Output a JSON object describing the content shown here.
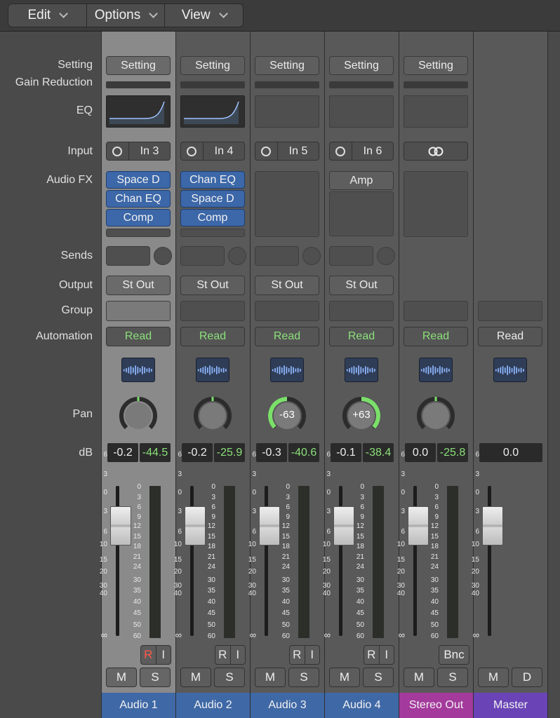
{
  "menubar": [
    {
      "label": "Edit"
    },
    {
      "label": "Options"
    },
    {
      "label": "View"
    }
  ],
  "row_labels": {
    "setting": "Setting",
    "gain_reduction": "Gain Reduction",
    "eq": "EQ",
    "input": "Input",
    "audio_fx": "Audio FX",
    "sends": "Sends",
    "output": "Output",
    "group": "Group",
    "automation": "Automation",
    "pan": "Pan",
    "db": "dB"
  },
  "fader_scale": [
    "6",
    "3",
    "0",
    "3",
    "6",
    "10",
    "15",
    "20",
    "30",
    "40",
    "∞"
  ],
  "meter_scale": [
    "0",
    "3",
    "6",
    "9",
    "12",
    "15",
    "18",
    "21",
    "24",
    "30",
    "35",
    "40",
    "45",
    "50",
    "60"
  ],
  "strips": [
    {
      "name": "Audio 1",
      "name_color": "#3f68a6",
      "selected": true,
      "setting": "Setting",
      "eq": true,
      "input": "In 3",
      "fx": [
        "Space D",
        "Chan EQ",
        "Comp"
      ],
      "sends": true,
      "output": "St Out",
      "automation": "Read",
      "pan_value": "",
      "pan_level": 0,
      "db_fader": "-0.2",
      "db_peak": "-44.5",
      "fader_level": 0,
      "rec": "R",
      "input_mon": "I",
      "mute": "M",
      "solo": "S",
      "rec_active": true
    },
    {
      "name": "Audio 2",
      "name_color": "#3f68a6",
      "selected": false,
      "setting": "Setting",
      "eq": true,
      "input": "In 4",
      "fx": [
        "Chan EQ",
        "Space D",
        "Comp"
      ],
      "sends": true,
      "output": "St Out",
      "automation": "Read",
      "pan_value": "",
      "pan_level": 0,
      "db_fader": "-0.2",
      "db_peak": "-25.9",
      "fader_level": 0,
      "rec": "R",
      "input_mon": "I",
      "mute": "M",
      "solo": "S",
      "rec_active": false
    },
    {
      "name": "Audio 3",
      "name_color": "#3f68a6",
      "selected": false,
      "setting": "Setting",
      "eq": false,
      "input": "In 5",
      "fx": [],
      "sends": true,
      "output": "St Out",
      "automation": "Read",
      "pan_value": "-63",
      "pan_level": -63,
      "db_fader": "-0.3",
      "db_peak": "-40.6",
      "fader_level": 0,
      "rec": "R",
      "input_mon": "I",
      "mute": "M",
      "solo": "S",
      "rec_active": false
    },
    {
      "name": "Audio 4",
      "name_color": "#3f68a6",
      "selected": false,
      "setting": "Setting",
      "eq": false,
      "input": "In 6",
      "fx": [
        "Amp"
      ],
      "sends": true,
      "output": "St Out",
      "automation": "Read",
      "pan_value": "+63",
      "pan_level": 63,
      "db_fader": "-0.1",
      "db_peak": "-38.4",
      "fader_level": 0,
      "rec": "R",
      "input_mon": "I",
      "mute": "M",
      "solo": "S",
      "rec_active": false
    },
    {
      "name": "Stereo Out",
      "name_color": "#a43a9c",
      "selected": false,
      "setting": "Setting",
      "eq": false,
      "input": "stereo-link",
      "fx": [],
      "sends": false,
      "output": "",
      "automation": "Read",
      "pan_value": "",
      "pan_level": 0,
      "db_fader": "0.0",
      "db_peak": "-25.8",
      "fader_level": 0,
      "bnc": "Bnc",
      "mute": "M",
      "solo": "S"
    },
    {
      "name": "Master",
      "name_color": "#6a44b6",
      "selected": false,
      "master": true,
      "automation": "Read",
      "db_fader": "0.0",
      "fader_level": 0,
      "mute": "M",
      "solo": "D"
    }
  ]
}
